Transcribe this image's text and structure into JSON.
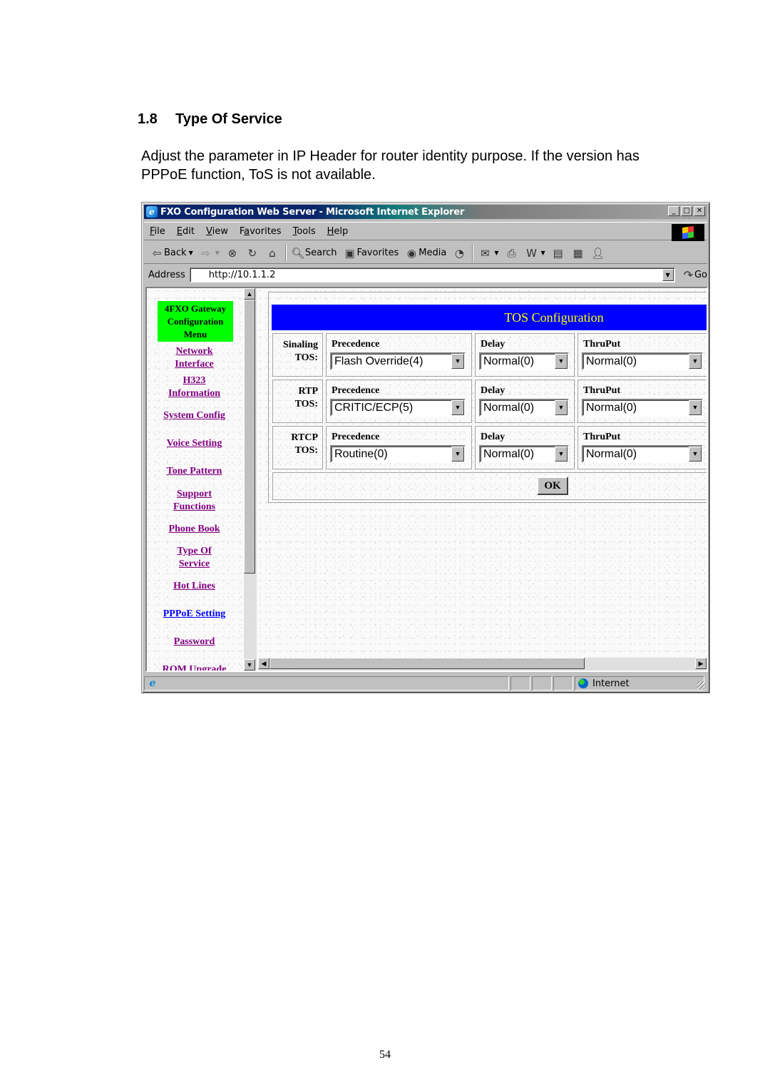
{
  "document": {
    "section_number": "1.8",
    "section_title": "Type Of Service",
    "paragraph": "Adjust the parameter in IP Header for router identity purpose. If the version has PPPoE function, ToS is not available.",
    "page_number": "54"
  },
  "browser": {
    "window_title": "FXO Configuration Web Server - Microsoft Internet Explorer",
    "window_buttons": {
      "minimize": "_",
      "maximize": "□",
      "close": "✕"
    },
    "menu": [
      {
        "label": "File",
        "accel": "F",
        "rest": "ile"
      },
      {
        "label": "Edit",
        "accel": "E",
        "rest": "dit"
      },
      {
        "label": "View",
        "accel": "V",
        "rest": "iew"
      },
      {
        "label": "Favorites",
        "accel": "a",
        "pre": "F",
        "rest": "vorites"
      },
      {
        "label": "Tools",
        "accel": "T",
        "rest": "ools"
      },
      {
        "label": "Help",
        "accel": "H",
        "rest": "elp"
      }
    ],
    "toolbar": {
      "back": "Back",
      "search": "Search",
      "favorites": "Favorites",
      "media": "Media"
    },
    "address": {
      "label": "Address",
      "value": "http://10.1.1.2",
      "go": "Go"
    },
    "status": {
      "zone": "Internet"
    }
  },
  "nav": {
    "header": [
      "4FXO Gateway",
      "Configuration",
      "Menu"
    ],
    "links": [
      {
        "lines": [
          "Network",
          "Interface"
        ]
      },
      {
        "lines": [
          "H323",
          "Information"
        ]
      },
      {
        "lines": [
          "System Config"
        ]
      },
      {
        "lines": [
          "Voice Setting"
        ]
      },
      {
        "lines": [
          "Tone Pattern"
        ]
      },
      {
        "lines": [
          "Support",
          "Functions"
        ]
      },
      {
        "lines": [
          "Phone Book"
        ]
      },
      {
        "lines": [
          "Type Of",
          "Service"
        ]
      },
      {
        "lines": [
          "Hot Lines"
        ]
      },
      {
        "lines": [
          "PPPoE Setting"
        ]
      },
      {
        "lines": [
          "Password"
        ]
      },
      {
        "lines": [
          "ROM Upgrade"
        ]
      }
    ]
  },
  "tos": {
    "title": "TOS Configuration",
    "field_labels": {
      "precedence": "Precedence",
      "delay": "Delay",
      "thruput": "ThruPut"
    },
    "rows": [
      {
        "label1": "Sinaling",
        "label2": "TOS:",
        "precedence": "Flash Override(4)",
        "delay": "Normal(0)",
        "thruput": "Normal(0)"
      },
      {
        "label1": "RTP",
        "label2": "TOS:",
        "precedence": "CRITIC/ECP(5)",
        "delay": "Normal(0)",
        "thruput": "Normal(0)"
      },
      {
        "label1": "RTCP",
        "label2": "TOS:",
        "precedence": "Routine(0)",
        "delay": "Normal(0)",
        "thruput": "Normal(0)"
      }
    ],
    "ok_label": "OK"
  }
}
